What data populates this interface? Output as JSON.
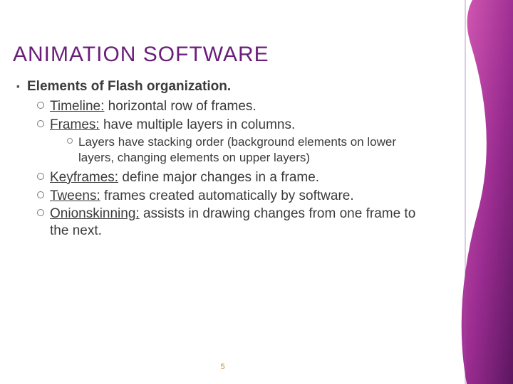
{
  "title": "ANIMATION SOFTWARE",
  "heading": "Elements of Flash organization.",
  "items": {
    "timeline": {
      "term": "Timeline:",
      "desc": " horizontal row of frames."
    },
    "frames": {
      "term": "Frames:",
      "desc": " have multiple layers in columns."
    },
    "layers_note": "Layers have stacking order (background elements on lower layers, changing elements on upper layers)",
    "keyframes": {
      "term": "Keyframes:",
      "desc": " define major changes in a frame."
    },
    "tweens": {
      "term": "Tweens:",
      "desc": " frames created automatically by software."
    },
    "onion": {
      "term": "Onionskinning:",
      "desc": " assists in drawing changes from one frame to the next."
    }
  },
  "page_number": "5"
}
